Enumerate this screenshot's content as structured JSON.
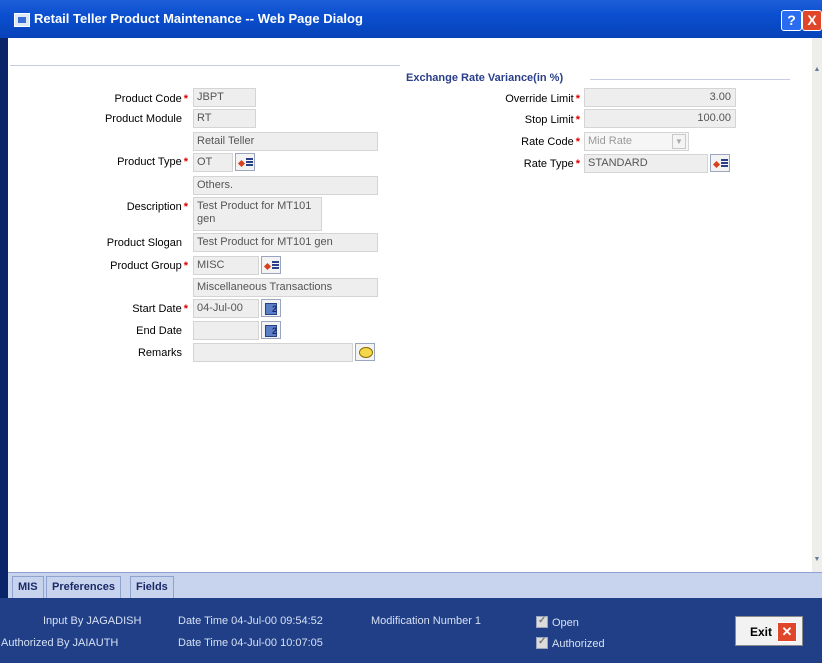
{
  "window": {
    "title": "Retail Teller Product Maintenance -- Web Page Dialog",
    "help_label": "?",
    "close_label": "X"
  },
  "form": {
    "product_code": {
      "label": "Product Code",
      "value": "JBPT"
    },
    "product_module": {
      "label": "Product Module",
      "value": "RT",
      "description": "Retail Teller"
    },
    "product_type": {
      "label": "Product Type",
      "value": "OT",
      "description": "Others."
    },
    "description": {
      "label": "Description",
      "value": "Test Product  for MT101 gen"
    },
    "product_slogan": {
      "label": "Product Slogan",
      "value": "Test Product for MT101 gen"
    },
    "product_group": {
      "label": "Product Group",
      "value": "MISC",
      "description": "Miscellaneous Transactions"
    },
    "start_date": {
      "label": "Start Date",
      "value": "04-Jul-00"
    },
    "end_date": {
      "label": "End Date",
      "value": ""
    },
    "remarks": {
      "label": "Remarks",
      "value": ""
    }
  },
  "exchange": {
    "section_title": "Exchange Rate Variance(in %)",
    "override_limit": {
      "label": "Override Limit",
      "value": "3.00"
    },
    "stop_limit": {
      "label": "Stop Limit",
      "value": "100.00"
    },
    "rate_code": {
      "label": "Rate Code",
      "value": "Mid Rate"
    },
    "rate_type": {
      "label": "Rate Type",
      "value": "STANDARD"
    }
  },
  "required_mark": "*",
  "tabs": [
    "MIS",
    "Preferences",
    "Fields"
  ],
  "footer": {
    "input_by": "Input By JAGADISH",
    "authorized_by": "Authorized By JAIAUTH",
    "input_datetime": "Date Time 04-Jul-00 09:54:52",
    "auth_datetime": "Date Time 04-Jul-00 10:07:05",
    "modification": "Modification Number 1",
    "open_label": "Open",
    "authorized_label": "Authorized",
    "exit_label": "Exit"
  }
}
